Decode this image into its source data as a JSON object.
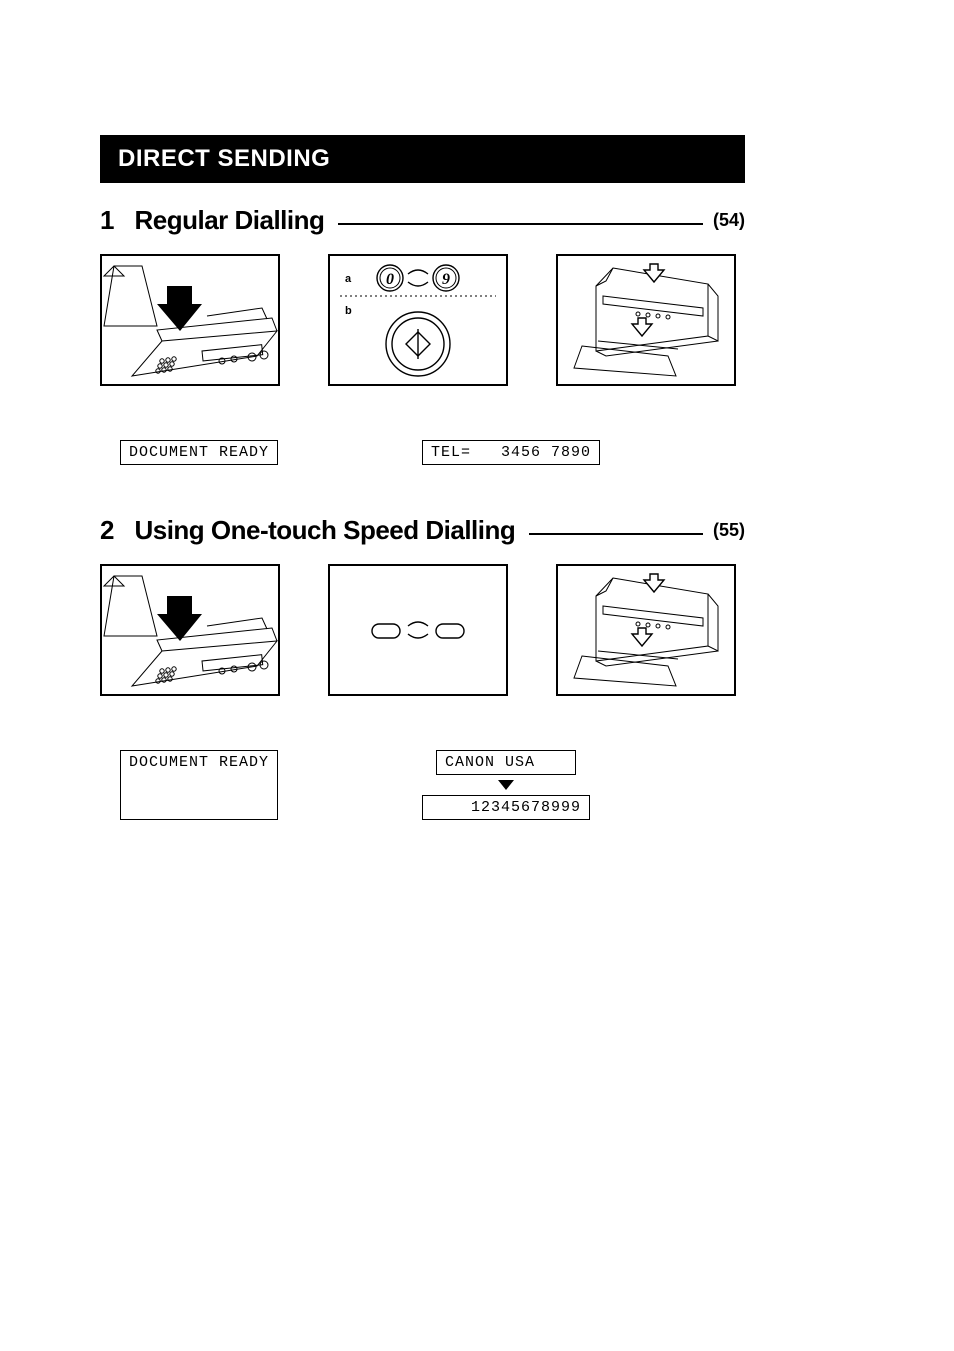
{
  "section_title": "DIRECT SENDING",
  "sub1": {
    "num": "1",
    "title": "Regular Dialling",
    "pageref": "(54)",
    "display1": "DOCUMENT READY",
    "display2": "TEL=   3456 7890",
    "step_a": "a",
    "step_b": "b",
    "key0": "0",
    "key9": "9"
  },
  "sub2": {
    "num": "2",
    "title": "Using One-touch Speed Dialling",
    "pageref": "(55)",
    "display1": "DOCUMENT READY",
    "display2a": "CANON USA",
    "display2b": "    12345678999"
  }
}
